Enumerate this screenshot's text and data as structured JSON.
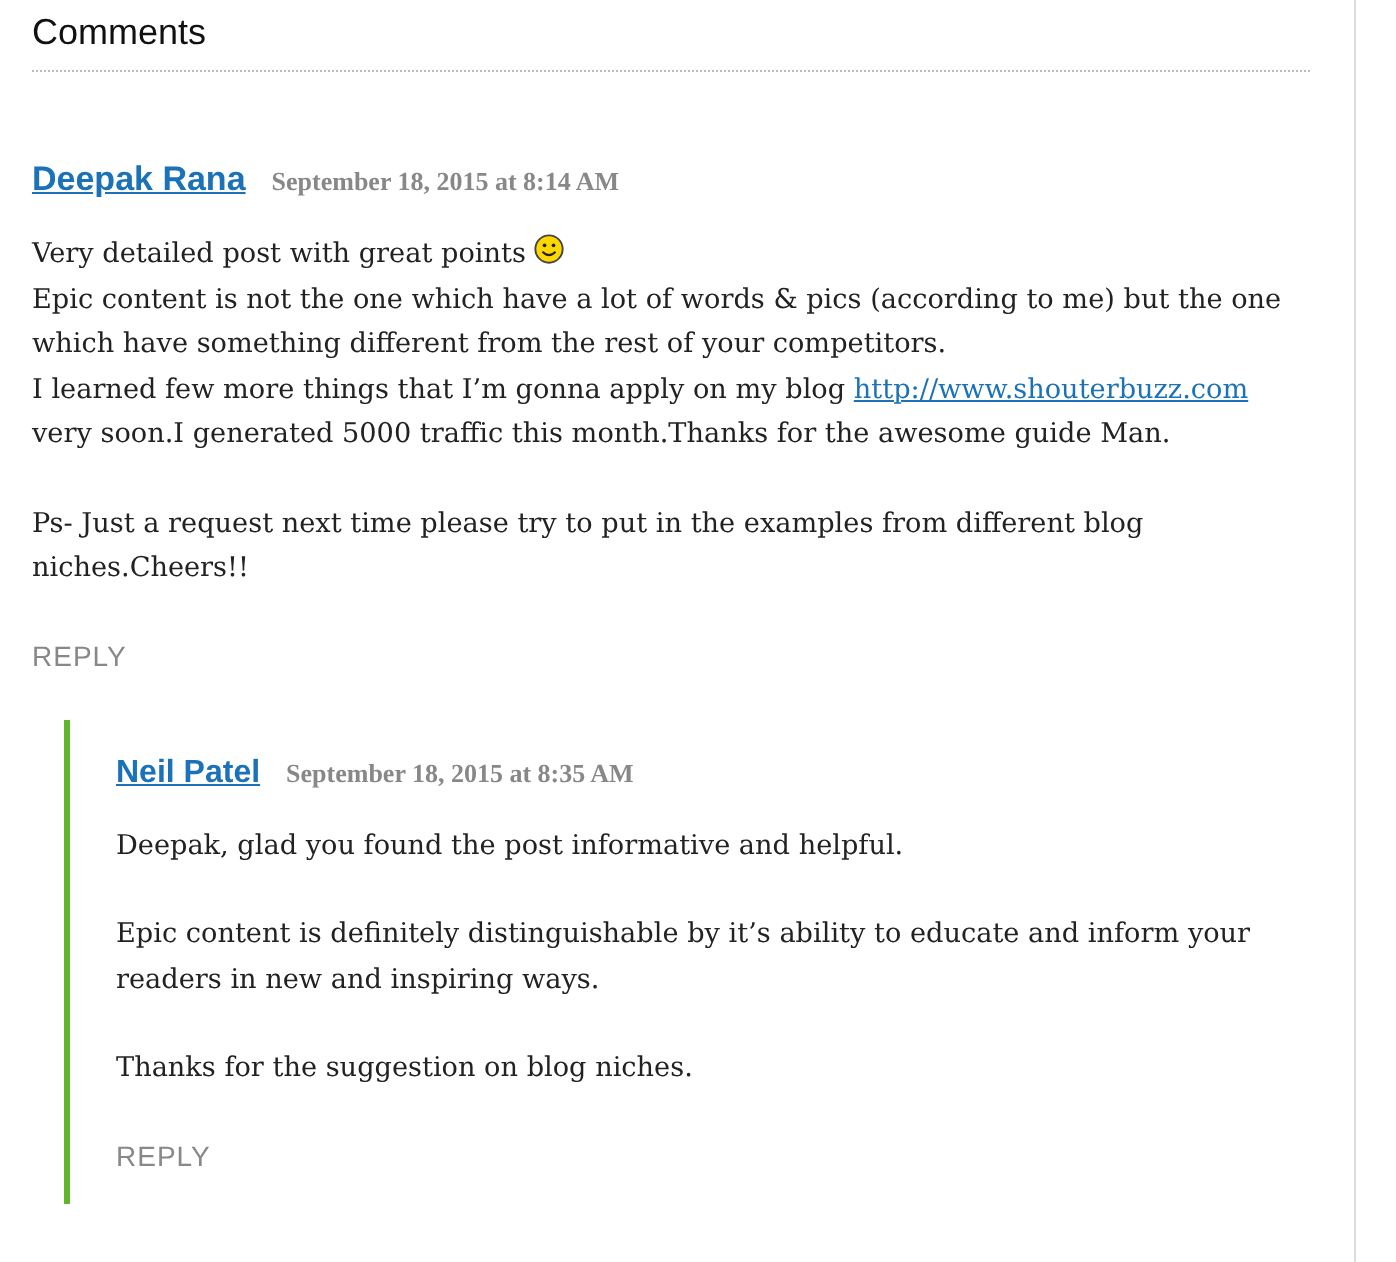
{
  "heading": "Comments",
  "comments": [
    {
      "author": "Deepak Rana",
      "date": "September 18, 2015 at 8:14 AM",
      "paragraphs": [
        [
          [
            {
              "kind": "text",
              "text": "Very detailed post with great points "
            },
            {
              "kind": "smiley"
            }
          ],
          [
            {
              "kind": "text",
              "text": "Epic content is not the one which have a lot of words & pics (according to me) but the one which have something different from the rest of your competitors."
            }
          ],
          [
            {
              "kind": "text",
              "text": "I learned few more things that I’m gonna apply on my blog "
            },
            {
              "kind": "link",
              "text": "http://www.shouterbuzz.com"
            },
            {
              "kind": "text",
              "text": " very soon.I generated 5000 traffic this month.Thanks for the awesome guide Man."
            }
          ]
        ],
        [
          [
            {
              "kind": "text",
              "text": "Ps- Just a request next time please try to put in the examples from different blog niches.Cheers!!"
            }
          ]
        ]
      ],
      "reply": "REPLY",
      "children": [
        {
          "author": "Neil Patel",
          "date": "September 18, 2015 at 8:35 AM",
          "paragraphs": [
            [
              [
                {
                  "kind": "text",
                  "text": "Deepak, glad you found the post informative and helpful."
                }
              ]
            ],
            [
              [
                {
                  "kind": "text",
                  "text": "Epic content is definitely distinguishable by it’s ability to educate and inform your readers in new and inspiring ways."
                }
              ]
            ],
            [
              [
                {
                  "kind": "text",
                  "text": "Thanks for the suggestion on blog niches."
                }
              ]
            ]
          ],
          "reply": "REPLY"
        }
      ]
    }
  ]
}
